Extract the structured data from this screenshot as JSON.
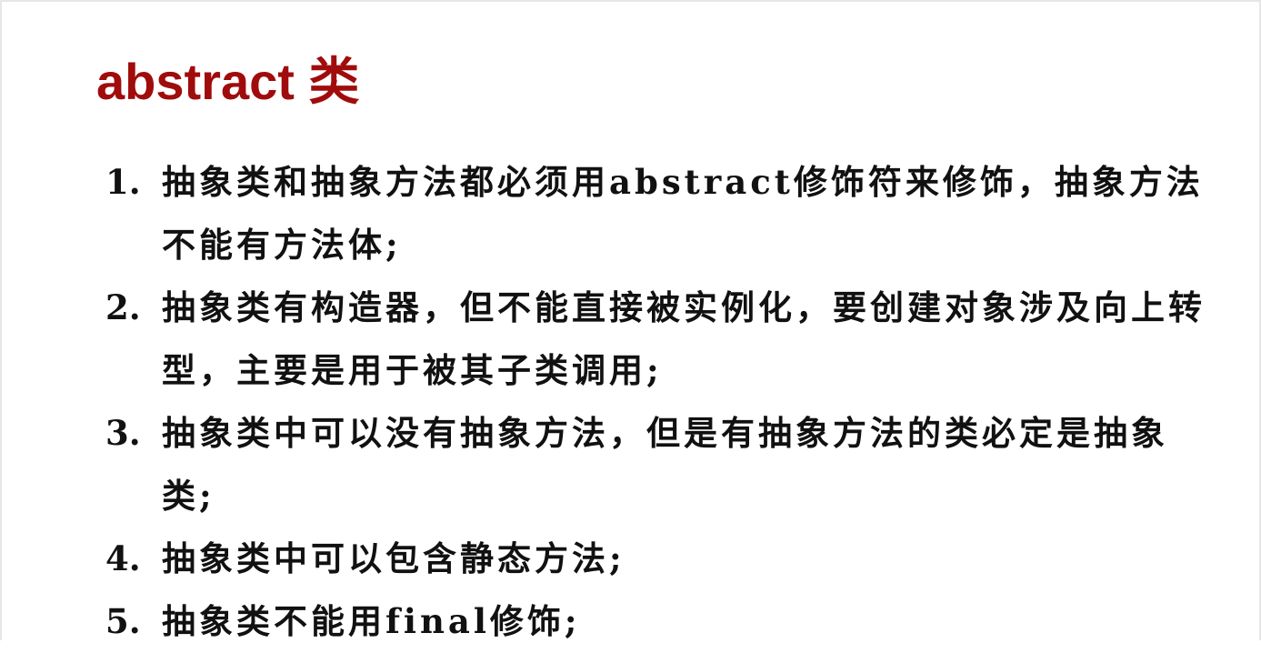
{
  "slide": {
    "title": "abstract 类",
    "title_color": "#a00c0c",
    "points": [
      {
        "number": "1.",
        "text": "抽象类和抽象方法都必须用abstract修饰符来修饰，抽象方法不能有方法体;"
      },
      {
        "number": "2.",
        "text": "抽象类有构造器，但不能直接被实例化，要创建对象涉及向上转型，主要是用于被其子类调用;"
      },
      {
        "number": "3.",
        "text": "抽象类中可以没有抽象方法，但是有抽象方法的类必定是抽象类;"
      },
      {
        "number": "4.",
        "text": "抽象类中可以包含静态方法;"
      },
      {
        "number": "5.",
        "text": "抽象类不能用final修饰;"
      }
    ]
  }
}
